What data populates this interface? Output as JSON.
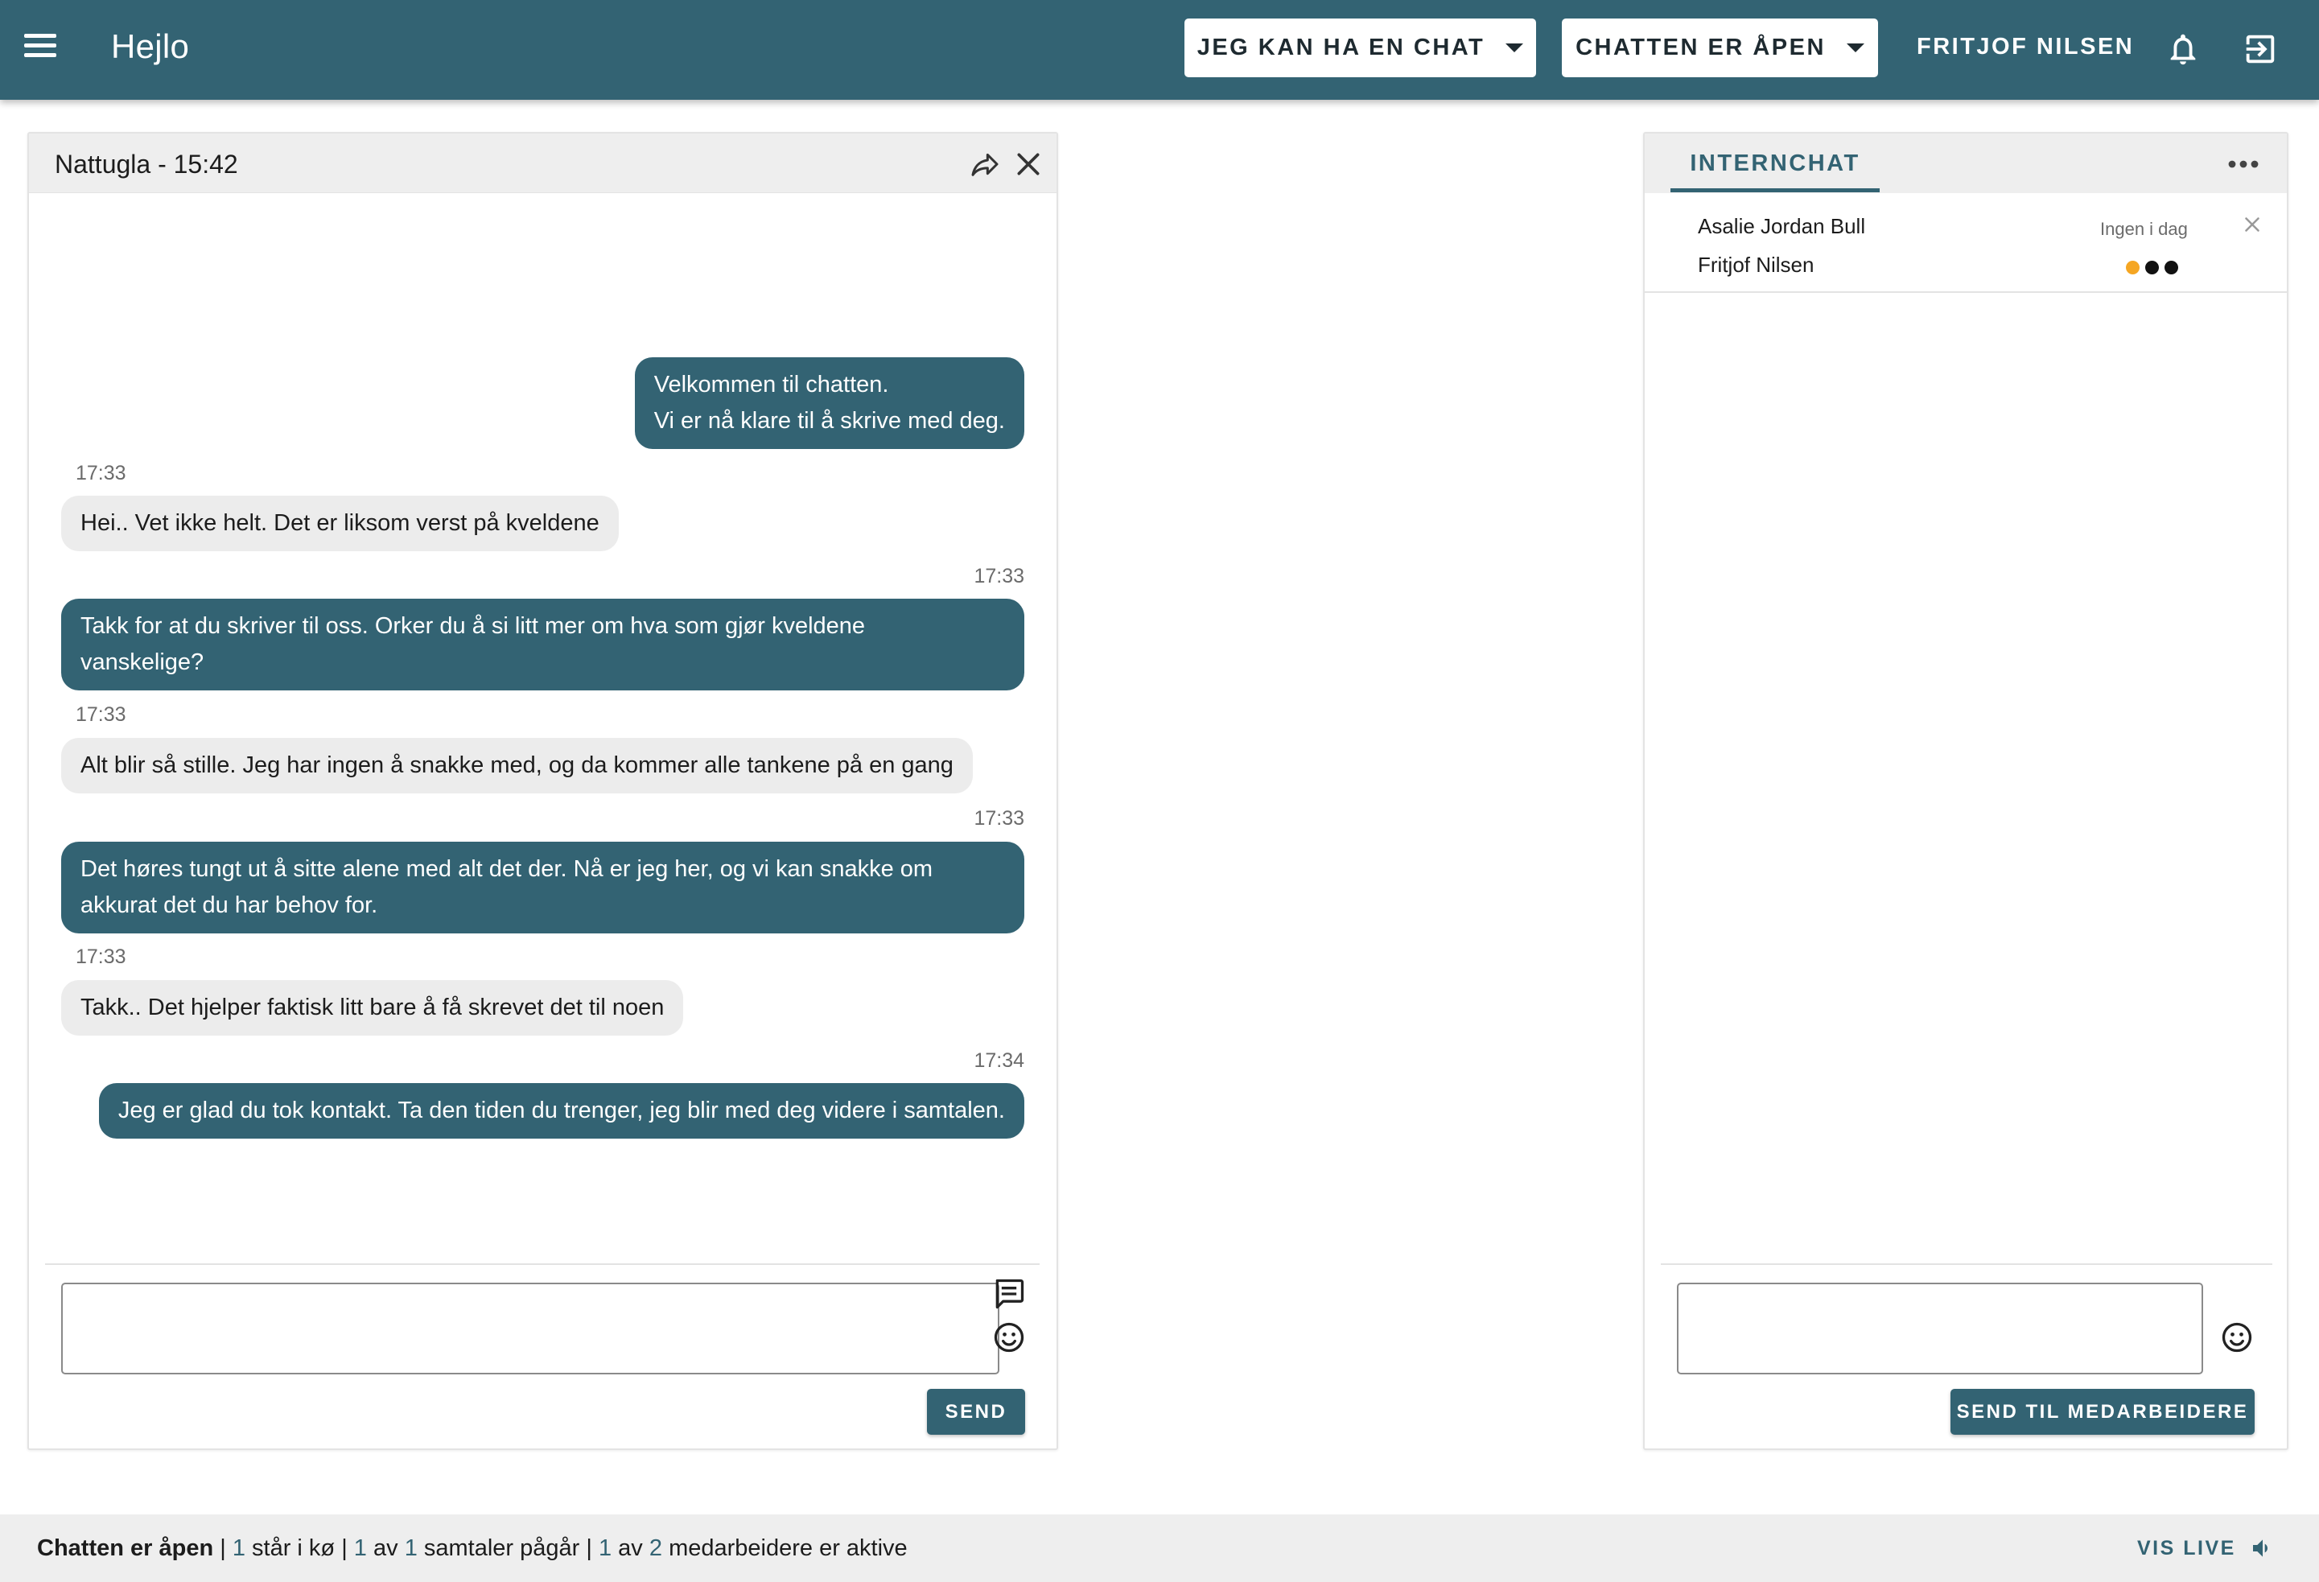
{
  "app": {
    "title": "Hejlo"
  },
  "topbar": {
    "availability_dropdown": "JEG KAN HA EN CHAT",
    "chat_status_dropdown": "CHATTEN ER ÅPEN",
    "user_name": "FRITJOF NILSEN"
  },
  "chat": {
    "title": "Nattugla - 15:42",
    "messages": [
      {
        "direction": "out",
        "time": "",
        "lines": [
          "Velkommen til chatten.",
          "Vi er nå klare til å skrive med deg."
        ]
      },
      {
        "direction": "in",
        "time": "17:33",
        "lines": [
          "Hei.. Vet ikke helt. Det er liksom verst på kveldene"
        ]
      },
      {
        "direction": "out",
        "time": "17:33",
        "lines": [
          "Takk for at du skriver til oss. Orker du å si litt mer om hva som gjør kveldene",
          "vanskelige?"
        ]
      },
      {
        "direction": "in",
        "time": "17:33",
        "lines": [
          "Alt blir så stille. Jeg har ingen å snakke med, og da kommer alle tankene på en gang"
        ]
      },
      {
        "direction": "out",
        "time": "17:33",
        "lines": [
          "Det høres tungt ut å sitte alene med alt det der. Nå er jeg her, og vi kan snakke om",
          "akkurat det du har behov for."
        ]
      },
      {
        "direction": "in",
        "time": "17:33",
        "lines": [
          "Takk.. Det hjelper faktisk litt bare å få skrevet det til noen"
        ]
      },
      {
        "direction": "out",
        "time": "17:34",
        "lines": [
          "Jeg er glad du tok kontakt. Ta den tiden du trenger, jeg blir med deg videre i samtalen."
        ]
      }
    ],
    "input_value": "",
    "send_label": "SEND"
  },
  "internchat": {
    "tab_label": "INTERNCHAT",
    "participants": [
      {
        "name": "Asalie Jordan Bull",
        "status": "Ingen i dag"
      },
      {
        "name": "Fritjof Nilsen",
        "status": ""
      }
    ],
    "typing_dot_colors": [
      "#f5a623",
      "#111111",
      "#111111"
    ],
    "input_value": "",
    "send_label": "SEND TIL MEDARBEIDERE"
  },
  "statusbar": {
    "open_label": "Chatten er åpen",
    "sep": " | ",
    "queue_count": "1",
    "queue_text": " står i kø",
    "active_count": "1",
    "of_text": " av ",
    "total_count": "1",
    "conv_text": " samtaler pågår",
    "staff_active": "1",
    "staff_total": "2",
    "staff_text": " medarbeidere er aktive",
    "vis_live_label": "VIS LIVE"
  },
  "colors": {
    "primary": "#336373",
    "incoming_bubble": "#ececec",
    "panel_header": "#eeeeee"
  }
}
